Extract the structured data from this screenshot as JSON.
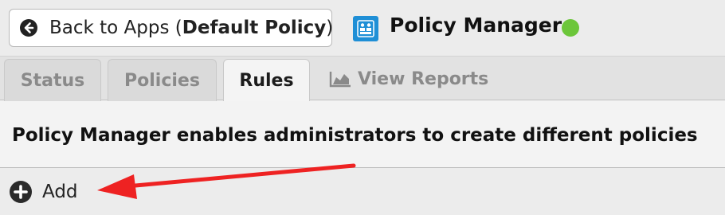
{
  "header": {
    "back_label": "Back to Apps (",
    "back_policy": "Default Policy",
    "back_close": ")",
    "app_title": "Policy Manager",
    "status_color": "#6cc63a",
    "logo_color": "#1f8fd6",
    "back_icon": "circle-arrow-left-icon",
    "logo_icon": "policy-manager-logo-icon"
  },
  "tabs": [
    {
      "label": "Status",
      "active": false
    },
    {
      "label": "Policies",
      "active": false
    },
    {
      "label": "Rules",
      "active": true
    },
    {
      "label": "View Reports",
      "active": false,
      "icon": "area-chart-icon"
    }
  ],
  "description": "Policy Manager enables administrators to create different policies",
  "toolbar": {
    "add_label": "Add",
    "add_icon": "plus-circle-icon"
  },
  "annotation": {
    "type": "arrow",
    "color": "#ee2222",
    "points_to": "add-button"
  }
}
